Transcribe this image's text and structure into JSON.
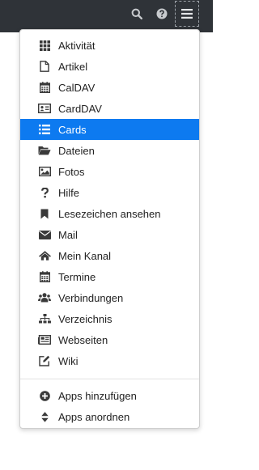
{
  "colors": {
    "topbar": "#2f3338",
    "active": "#0d7af0",
    "icon": "#3a3a3a"
  },
  "topbar": {
    "icons": [
      "search-icon",
      "help-icon",
      "menu-icon"
    ]
  },
  "menu": {
    "items": [
      {
        "label": "Aktivität",
        "icon": "grid-icon"
      },
      {
        "label": "Artikel",
        "icon": "document-icon"
      },
      {
        "label": "CalDAV",
        "icon": "calendar-icon"
      },
      {
        "label": "CardDAV",
        "icon": "address-card-icon"
      },
      {
        "label": "Cards",
        "icon": "list-icon",
        "active": true
      },
      {
        "label": "Dateien",
        "icon": "folder-icon"
      },
      {
        "label": "Fotos",
        "icon": "image-icon"
      },
      {
        "label": "Hilfe",
        "icon": "question-icon"
      },
      {
        "label": "Lesezeichen ansehen",
        "icon": "bookmark-icon"
      },
      {
        "label": "Mail",
        "icon": "envelope-icon"
      },
      {
        "label": "Mein Kanal",
        "icon": "home-icon"
      },
      {
        "label": "Termine",
        "icon": "calendar-icon"
      },
      {
        "label": "Verbindungen",
        "icon": "users-icon"
      },
      {
        "label": "Verzeichnis",
        "icon": "sitemap-icon"
      },
      {
        "label": "Webseiten",
        "icon": "newspaper-icon"
      },
      {
        "label": "Wiki",
        "icon": "edit-icon"
      }
    ],
    "footer_items": [
      {
        "label": "Apps hinzufügen",
        "icon": "plus-circle-icon"
      },
      {
        "label": "Apps anordnen",
        "icon": "sort-icon"
      }
    ]
  }
}
